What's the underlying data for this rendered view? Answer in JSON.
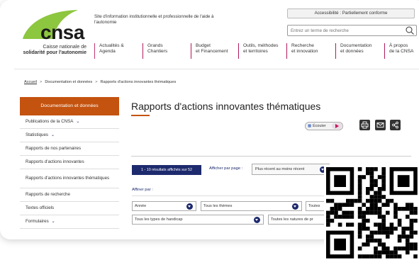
{
  "header": {
    "logo_text": "cnsa",
    "tagline": "Site d'information institutionnelle et professionnelle de l'aide à l'autonomie",
    "caisse_line1": "Caisse nationale de",
    "caisse_line2": "solidarité pour l'autonomie",
    "accessibility": "Accessibilité : Partiellement conforme",
    "search_placeholder": "Entrez un terme de recherche",
    "brand_green": "#8dc63f"
  },
  "nav": [
    {
      "line1": "Actualités &",
      "line2": "Agenda"
    },
    {
      "line1": "Grands",
      "line2": "Chantiers"
    },
    {
      "line1": "Budget",
      "line2": "et Financement"
    },
    {
      "line1": "Outils, méthodes",
      "line2": "et territoires"
    },
    {
      "line1": "Recherche",
      "line2": "et innovation"
    },
    {
      "line1": "Documentation",
      "line2": "et données"
    },
    {
      "line1": "À propos",
      "line2": "de la CNSA"
    }
  ],
  "breadcrumb": {
    "home": "Accueil",
    "level1": "Documentation et données",
    "level2": "Rapports d'actions innovantes thématiques"
  },
  "sidebar": {
    "heading": "Documentation et données",
    "items": [
      {
        "label": "Publications de la CNSA",
        "chevron": true
      },
      {
        "label": "Statistiques",
        "chevron": true
      },
      {
        "label": "Rapports de nos partenaires",
        "chevron": false
      },
      {
        "label": "Rapports d'actions innovantes",
        "chevron": false
      },
      {
        "label": "Rapports d'actions innovantes thématiques",
        "chevron": false
      },
      {
        "label": "Rapports de recherche",
        "chevron": false
      },
      {
        "label": "Textes officiels",
        "chevron": false
      },
      {
        "label": "Formulaires",
        "chevron": true
      }
    ]
  },
  "main": {
    "title": "Rapports d'actions innovantes thématiques",
    "listen_label": "Écouter",
    "results": "1 - 10 résultats affichés sur 52",
    "per_page_label": "Afficher par page :",
    "sort_value": "Plus récent au moins récent",
    "refine_label": "Affiner par :",
    "filters": {
      "year": "Année",
      "themes": "Tous les thèmes",
      "all": "Toutes",
      "handicap": "Tous les types de handicap",
      "natures": "Toutes les natures de pr"
    }
  },
  "colors": {
    "accent_orange": "#c4530f",
    "navy": "#1d2a6d",
    "magenta": "#b0195b"
  },
  "icons": [
    "search-icon",
    "speaker-icon",
    "play-icon",
    "print-icon",
    "email-icon",
    "share-icon",
    "chevron-down-icon",
    "qr-code"
  ]
}
